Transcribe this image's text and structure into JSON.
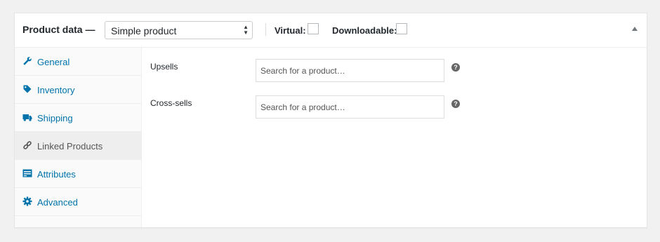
{
  "header": {
    "title": "Product data —",
    "product_type": "Simple product",
    "virtual_label": "Virtual:",
    "downloadable_label": "Downloadable:",
    "virtual_checked": false,
    "downloadable_checked": false
  },
  "tabs": [
    {
      "label": "General",
      "icon": "wrench-icon",
      "active": false
    },
    {
      "label": "Inventory",
      "icon": "tag-icon",
      "active": false
    },
    {
      "label": "Shipping",
      "icon": "truck-icon",
      "active": false
    },
    {
      "label": "Linked Products",
      "icon": "link-icon",
      "active": true
    },
    {
      "label": "Attributes",
      "icon": "list-icon",
      "active": false
    },
    {
      "label": "Advanced",
      "icon": "gear-icon",
      "active": false
    }
  ],
  "fields": {
    "upsells": {
      "label": "Upsells",
      "placeholder": "Search for a product…"
    },
    "crosssells": {
      "label": "Cross-sells",
      "placeholder": "Search for a product…"
    }
  },
  "colors": {
    "link": "#0073aa",
    "active_tab_bg": "#eeeeee"
  }
}
